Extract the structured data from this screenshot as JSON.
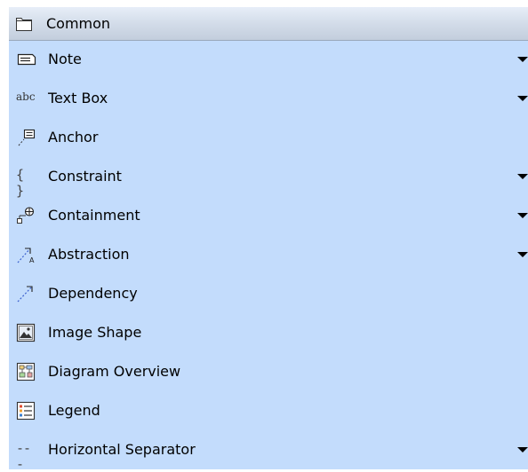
{
  "palette": {
    "group": {
      "label": "Common",
      "icon": "folder-icon"
    },
    "items": [
      {
        "label": "Note",
        "icon": "note-icon",
        "has_dropdown": true
      },
      {
        "label": "Text Box",
        "icon": "text-box-icon",
        "icon_text": "abc",
        "has_dropdown": true
      },
      {
        "label": "Anchor",
        "icon": "anchor-icon",
        "has_dropdown": false
      },
      {
        "label": "Constraint",
        "icon": "constraint-icon",
        "icon_text": "{ }",
        "has_dropdown": true
      },
      {
        "label": "Containment",
        "icon": "containment-icon",
        "has_dropdown": true
      },
      {
        "label": "Abstraction",
        "icon": "abstraction-icon",
        "has_dropdown": true
      },
      {
        "label": "Dependency",
        "icon": "dependency-icon",
        "has_dropdown": false
      },
      {
        "label": "Image Shape",
        "icon": "image-icon",
        "has_dropdown": false
      },
      {
        "label": "Diagram Overview",
        "icon": "diagram-overview-icon",
        "has_dropdown": false
      },
      {
        "label": "Legend",
        "icon": "legend-icon",
        "has_dropdown": false
      },
      {
        "label": "Horizontal Separator",
        "icon": "separator-icon",
        "icon_text": "---",
        "has_dropdown": true
      }
    ],
    "colors": {
      "background": "#c3dcfc",
      "header": "#d3dce9",
      "dependency_line": "#3a5fcd"
    }
  }
}
